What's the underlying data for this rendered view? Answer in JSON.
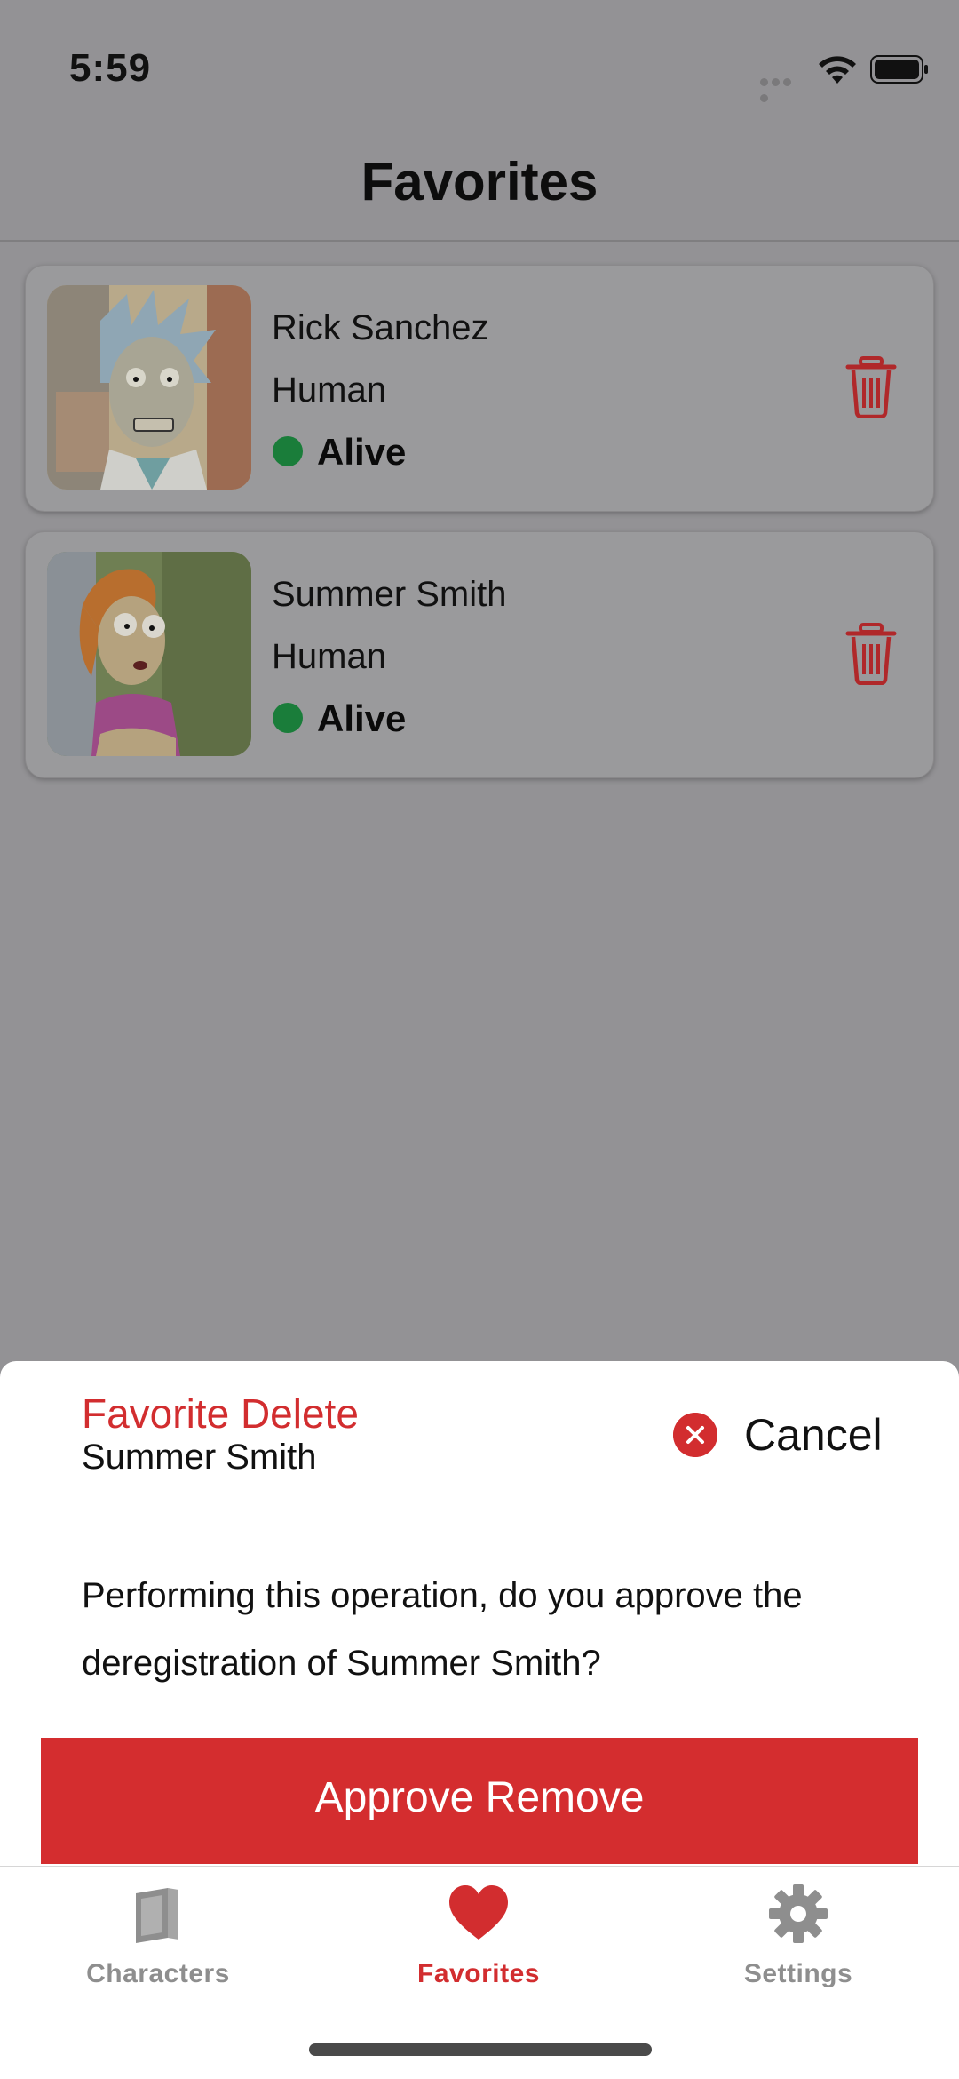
{
  "status_bar": {
    "time": "5:59"
  },
  "nav": {
    "title": "Favorites"
  },
  "favorites": [
    {
      "name": "Rick Sanchez",
      "species": "Human",
      "status": "Alive",
      "status_color": "#1a7d3a",
      "avatar_icon": "rick-avatar"
    },
    {
      "name": "Summer Smith",
      "species": "Human",
      "status": "Alive",
      "status_color": "#1a7d3a",
      "avatar_icon": "summer-avatar"
    }
  ],
  "sheet": {
    "title": "Favorite Delete",
    "subtitle": "Summer Smith",
    "cancel_label": "Cancel",
    "message": "Performing this operation, do you approve the deregistration of Summer Smith?",
    "approve_label": "Approve Remove"
  },
  "tabs": [
    {
      "label": "Characters",
      "icon": "book-icon",
      "active": false
    },
    {
      "label": "Favorites",
      "icon": "heart-icon",
      "active": true
    },
    {
      "label": "Settings",
      "icon": "gear-icon",
      "active": false
    }
  ],
  "colors": {
    "accent": "#d22d2f",
    "alive": "#1a7d3a",
    "tab_inactive": "#8e8e8e"
  }
}
